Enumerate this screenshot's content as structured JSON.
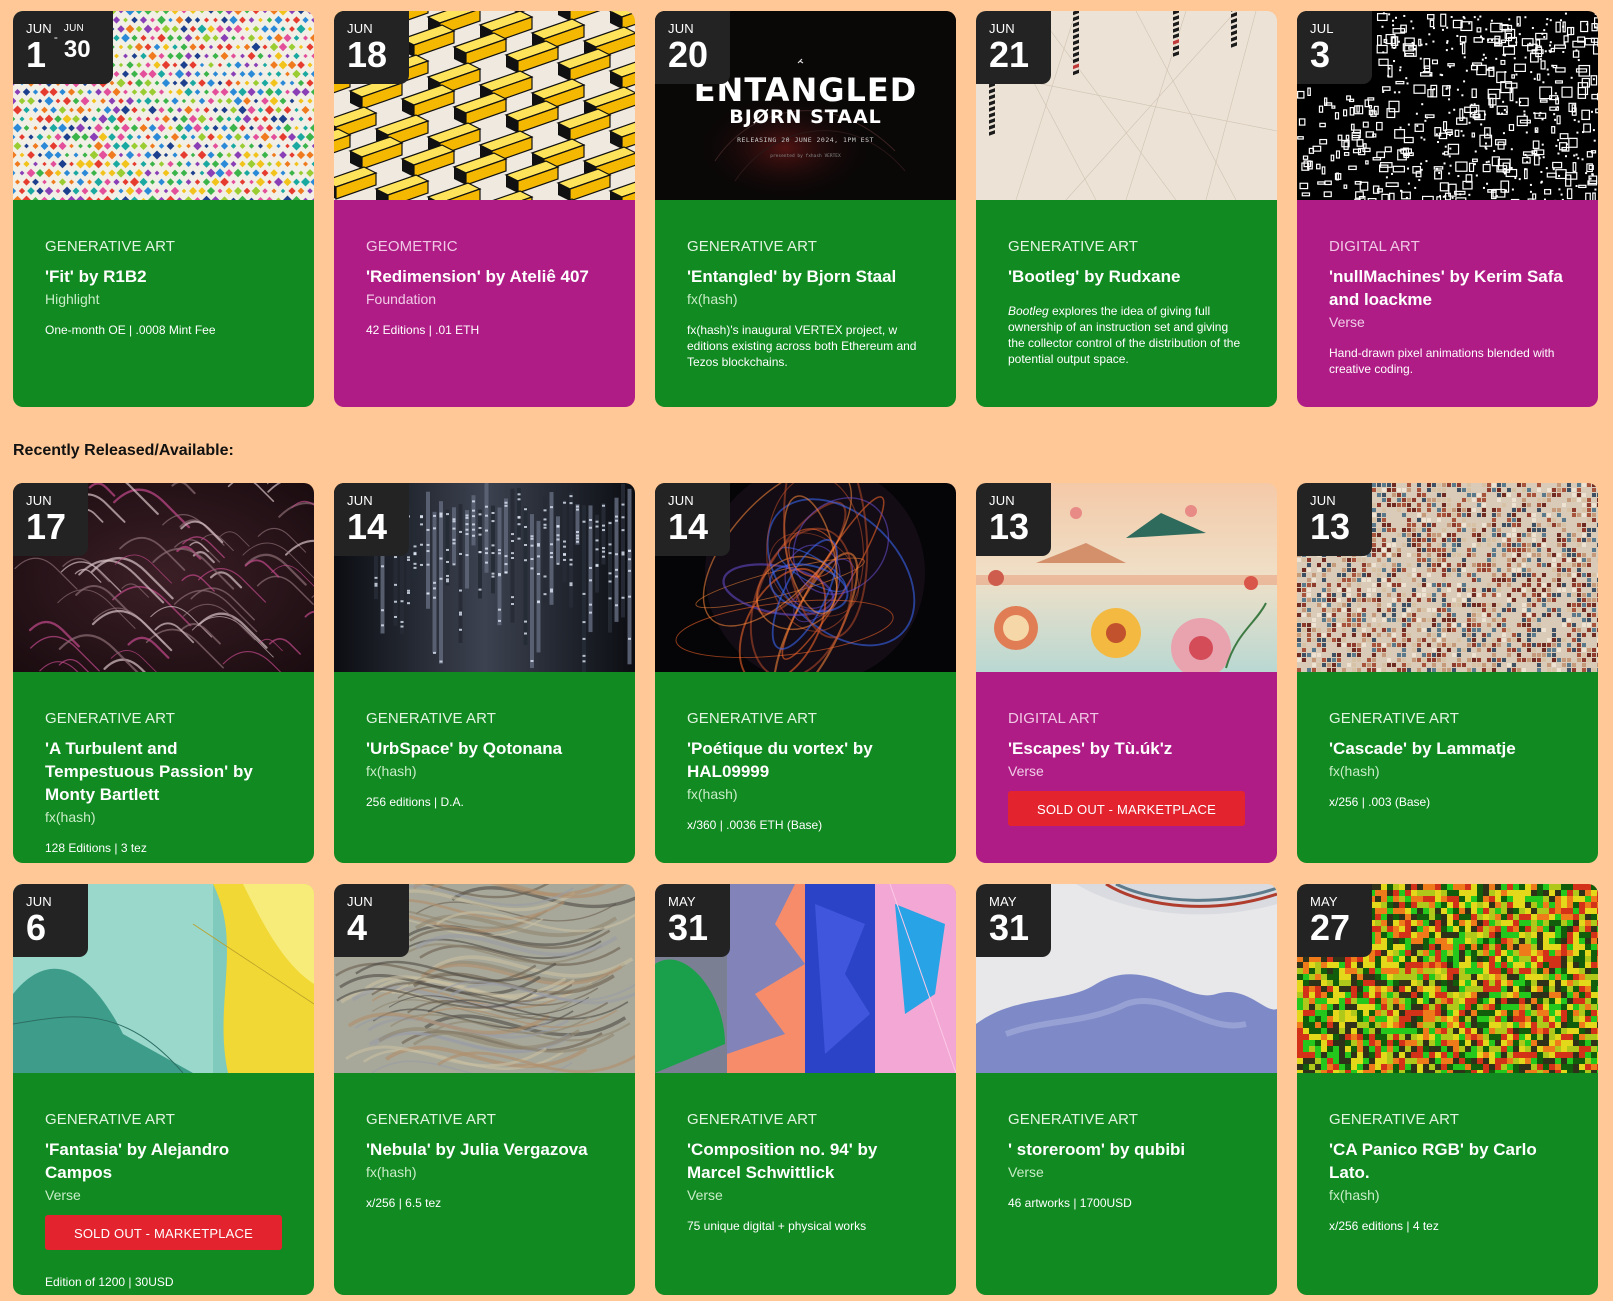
{
  "section_heading": "Recently Released/Available:",
  "colors": {
    "page_bg": "#ffc896",
    "green": "#118a21",
    "magenta": "#b01c86",
    "date_bg": "#232323",
    "button_red": "#e3242f"
  },
  "upcoming": [
    {
      "month": "JUN",
      "day": "1",
      "end_month": "JUN",
      "end_day": "30",
      "category": "GENERATIVE ART",
      "title": "'Fit' by R1B2",
      "platform": "Highlight",
      "desc": "One-month OE | .0008 Mint Fee"
    },
    {
      "month": "JUN",
      "day": "18",
      "category": "GEOMETRIC",
      "title": "'Redimension' by Ateliê 407",
      "platform": "Foundation",
      "desc": "42 Editions | .01 ETH"
    },
    {
      "month": "JUN",
      "day": "20",
      "category": "GENERATIVE ART",
      "title": "'Entangled' by Bjorn Staal",
      "platform": "fx(hash)",
      "desc": "fx(hash)'s inaugural VERTEX project, w editions existing across both Ethereum and Tezos blockchains.",
      "art_title": "ENTANGLED",
      "art_artist": "BJØRN STAAL",
      "art_release": "RELEASING 20 JUNE 2024, 1PM EST",
      "art_presented": "presented by fxhash VERTEX"
    },
    {
      "month": "JUN",
      "day": "21",
      "category": "GENERATIVE ART",
      "title": "'Bootleg' by Rudxane",
      "platform": "",
      "desc_em": "Bootleg",
      "desc": " explores the idea of giving full ownership of an instruction set and giving the collector control of the distribution of the potential output space."
    },
    {
      "month": "JUL",
      "day": "3",
      "category": "DIGITAL ART",
      "title": "'nullMachines' by Kerim Safa and loackme",
      "platform": "Verse",
      "desc": "Hand-drawn pixel animations blended with creative coding."
    }
  ],
  "released_row_1": [
    {
      "month": "JUN",
      "day": "17",
      "category": "GENERATIVE ART",
      "title": "'A Turbulent and Tempestuous Passion' by Monty Bartlett",
      "platform": "fx(hash)",
      "desc": "128 Editions | 3 tez"
    },
    {
      "month": "JUN",
      "day": "14",
      "category": "GENERATIVE ART",
      "title": "'UrbSpace' by Qotonana",
      "platform": "fx(hash)",
      "desc": "256 editions | D.A."
    },
    {
      "month": "JUN",
      "day": "14",
      "category": "GENERATIVE ART",
      "title": "'Poétique du vortex' by HAL09999",
      "platform": "fx(hash)",
      "desc": "x/360 | .0036 ETH (Base)"
    },
    {
      "month": "JUN",
      "day": "13",
      "category": "DIGITAL ART",
      "title": "'Escapes' by Tù.úk'z",
      "platform": "Verse",
      "button": "SOLD OUT - MARKETPLACE"
    },
    {
      "month": "JUN",
      "day": "13",
      "category": "GENERATIVE ART",
      "title": "'Cascade' by Lammatje",
      "platform": "fx(hash)",
      "desc": "x/256 | .003 (Base)"
    }
  ],
  "released_row_2": [
    {
      "month": "JUN",
      "day": "6",
      "category": "GENERATIVE ART",
      "title": "'Fantasia' by Alejandro Campos",
      "platform": "Verse",
      "button": "SOLD OUT - MARKETPLACE",
      "desc": "Edition of 1200 | 30USD"
    },
    {
      "month": "JUN",
      "day": "4",
      "category": "GENERATIVE ART",
      "title": "'Nebula' by Julia Vergazova",
      "platform": "fx(hash)",
      "desc": "x/256 | 6.5 tez"
    },
    {
      "month": "MAY",
      "day": "31",
      "category": "GENERATIVE ART",
      "title": "'Composition no. 94' by Marcel Schwittlick",
      "platform": "Verse",
      "desc": "75 unique digital + physical works"
    },
    {
      "month": "MAY",
      "day": "31",
      "category": "GENERATIVE ART",
      "title": "' storeroom' by qubibi",
      "platform": "Verse",
      "desc": "46 artworks | 1700USD"
    },
    {
      "month": "MAY",
      "day": "27",
      "category": "GENERATIVE ART",
      "title": "'CA Panico RGB' by Carlo Lato.",
      "platform": "fx(hash)",
      "desc": "x/256 editions | 4 tez"
    }
  ]
}
